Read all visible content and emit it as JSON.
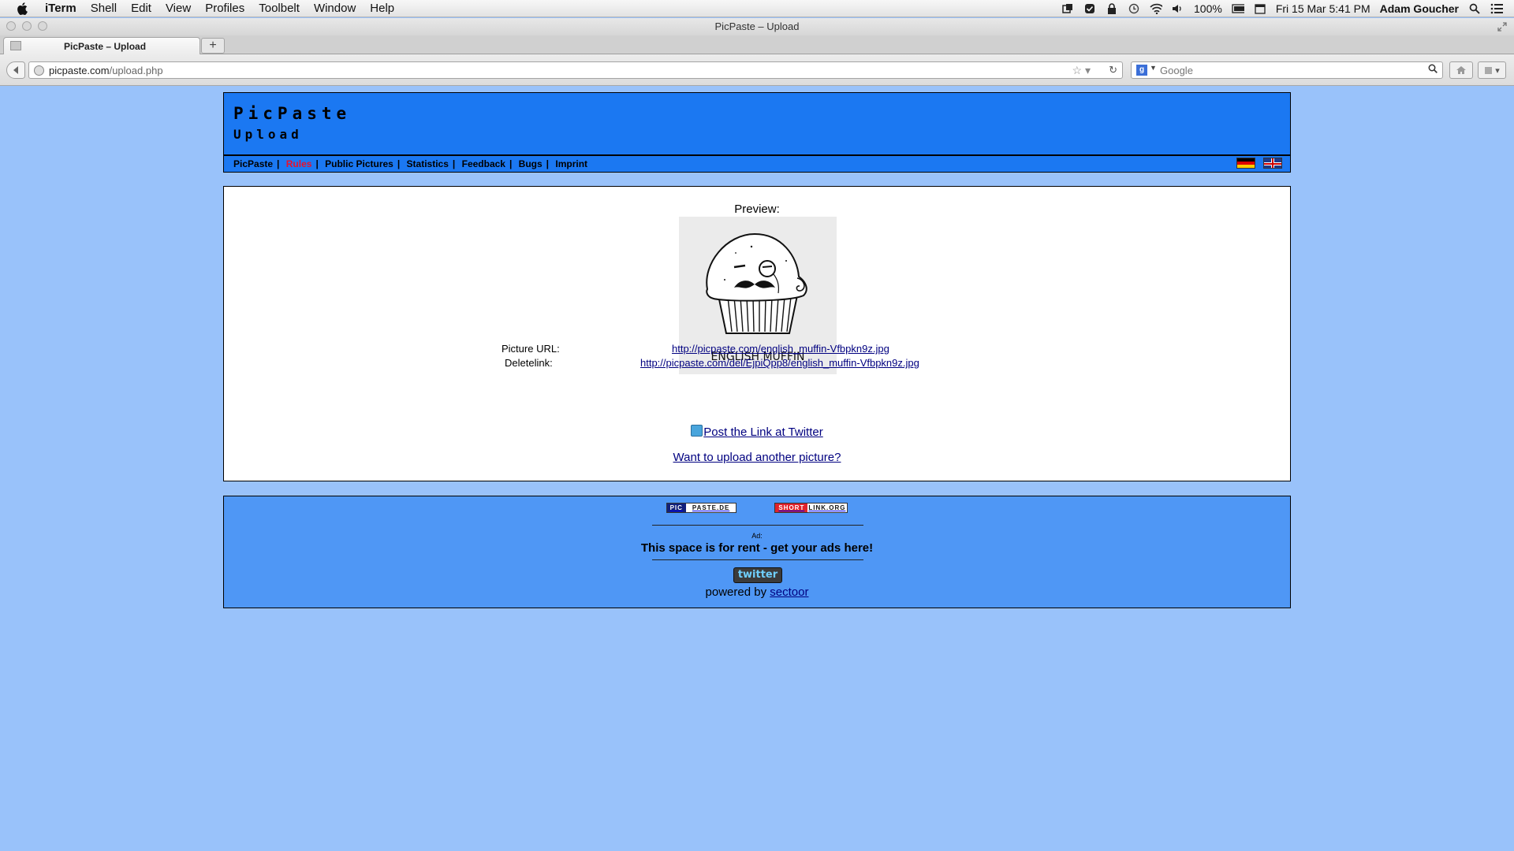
{
  "menubar": {
    "app_name": "iTerm",
    "items": [
      "Shell",
      "Edit",
      "View",
      "Profiles",
      "Toolbelt",
      "Window",
      "Help"
    ],
    "battery": "100%",
    "datetime": "Fri 15 Mar  5:41 PM",
    "user": "Adam Goucher"
  },
  "browser": {
    "window_title": "PicPaste – Upload",
    "tab_label": "PicPaste – Upload",
    "url_domain": "picpaste.com",
    "url_path": "/upload.php",
    "search_engine": "Google",
    "search_placeholder": "Google"
  },
  "site": {
    "title": "PicPaste",
    "subtitle": "Upload",
    "nav": [
      "PicPaste",
      "Rules",
      "Public Pictures",
      "Statistics",
      "Feedback",
      "Bugs",
      "Imprint"
    ],
    "active_nav": "Rules"
  },
  "content": {
    "preview_label": "Preview:",
    "image_caption": "ENGLISH MUFFIN",
    "picture_url_label": "Picture URL:",
    "picture_url": "http://picpaste.com/english_muffin-Vfbpkn9z.jpg",
    "deletelink_label": "Deletelink:",
    "deletelink": "http://picpaste.com/del/EjpiQpp8/english_muffin-Vfbpkn9z.jpg",
    "twitter_link": "Post the Link at Twitter",
    "upload_another": "Want to upload another picture?"
  },
  "footer": {
    "logo1_a": "PIC",
    "logo1_b": "PASTE.DE",
    "logo2_a": "SHORT",
    "logo2_b": "LINK.ORG",
    "ad_label": "Ad:",
    "ad_text": "This space is for rent - get your ads here!",
    "twitter_button": "twitter",
    "powered_by": "powered by",
    "powered_link": "sectoor"
  },
  "colors": {
    "page_bg": "#99c2fa",
    "header_bg": "#1b78f2",
    "footer_bg": "#4f97f5",
    "active_nav": "#e8112d",
    "link": "#000080"
  }
}
